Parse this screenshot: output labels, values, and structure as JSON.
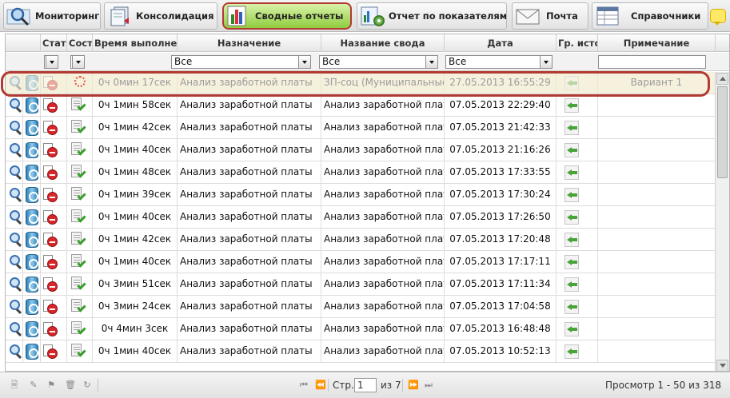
{
  "tabs": [
    {
      "label": "Мониторинг",
      "icon": "monitoring-magnifier-icon"
    },
    {
      "label": "Консолидация",
      "icon": "consolidation-documents-icon"
    },
    {
      "label": "Сводные отчеты",
      "icon": "summary-reports-chart-icon",
      "active": true
    },
    {
      "label": "Отчет по показателям",
      "icon": "indicators-report-gear-icon"
    },
    {
      "label": "Почта",
      "icon": "mail-envelope-icon"
    },
    {
      "label": "Справочники",
      "icon": "reference-books-table-icon"
    }
  ],
  "columns": [
    "Стат",
    "Сост",
    "Время выполне",
    "Назначение",
    "Название свода",
    "Дата",
    "Гр. исто",
    "Примечание"
  ],
  "filters": {
    "naznachenie": "Все",
    "nazvanie": "Все",
    "data": "Все"
  },
  "rows": [
    {
      "time": "0ч 0мин 17сек",
      "purpose": "Анализ заработной платы",
      "name": "ЗП-соц (Муниципальные уч",
      "date": "27.05.2013 16:55:29",
      "note": "Вариант 1",
      "state": "processing"
    },
    {
      "time": "0ч 1мин 58сек",
      "purpose": "Анализ заработной платы",
      "name": "Анализ заработной платы",
      "date": "07.05.2013 22:29:40",
      "note": "",
      "state": "done"
    },
    {
      "time": "0ч 1мин 42сек",
      "purpose": "Анализ заработной платы",
      "name": "Анализ заработной платы",
      "date": "07.05.2013 21:42:33",
      "note": "",
      "state": "done"
    },
    {
      "time": "0ч 1мин 40сек",
      "purpose": "Анализ заработной платы",
      "name": "Анализ заработной платы",
      "date": "07.05.2013 21:16:26",
      "note": "",
      "state": "done"
    },
    {
      "time": "0ч 1мин 48сек",
      "purpose": "Анализ заработной платы",
      "name": "Анализ заработной платы",
      "date": "07.05.2013 17:33:55",
      "note": "",
      "state": "done"
    },
    {
      "time": "0ч 1мин 39сек",
      "purpose": "Анализ заработной платы",
      "name": "Анализ заработной платы",
      "date": "07.05.2013 17:30:24",
      "note": "",
      "state": "done"
    },
    {
      "time": "0ч 1мин 40сек",
      "purpose": "Анализ заработной платы",
      "name": "Анализ заработной платы",
      "date": "07.05.2013 17:26:50",
      "note": "",
      "state": "done"
    },
    {
      "time": "0ч 1мин 42сек",
      "purpose": "Анализ заработной платы",
      "name": "Анализ заработной платы",
      "date": "07.05.2013 17:20:48",
      "note": "",
      "state": "done"
    },
    {
      "time": "0ч 1мин 40сек",
      "purpose": "Анализ заработной платы",
      "name": "Анализ заработной платы",
      "date": "07.05.2013 17:17:11",
      "note": "",
      "state": "done"
    },
    {
      "time": "0ч 3мин 51сек",
      "purpose": "Анализ заработной платы",
      "name": "Анализ заработной платы",
      "date": "07.05.2013 17:11:34",
      "note": "",
      "state": "done"
    },
    {
      "time": "0ч 3мин 24сек",
      "purpose": "Анализ заработной платы",
      "name": "Анализ заработной платы",
      "date": "07.05.2013 17:04:58",
      "note": "",
      "state": "done"
    },
    {
      "time": "0ч 4мин 3сек",
      "purpose": "Анализ заработной платы",
      "name": "Анализ заработной платы",
      "date": "07.05.2013 16:48:48",
      "note": "",
      "state": "done"
    },
    {
      "time": "0ч 1мин 40сек",
      "purpose": "Анализ заработной платы",
      "name": "Анализ заработной платы",
      "date": "07.05.2013 10:52:13",
      "note": "",
      "state": "done"
    }
  ],
  "pager": {
    "page_label": "Стр.",
    "page": "1",
    "of_label": "из 7",
    "summary": "Просмотр 1 - 50 из 318"
  }
}
